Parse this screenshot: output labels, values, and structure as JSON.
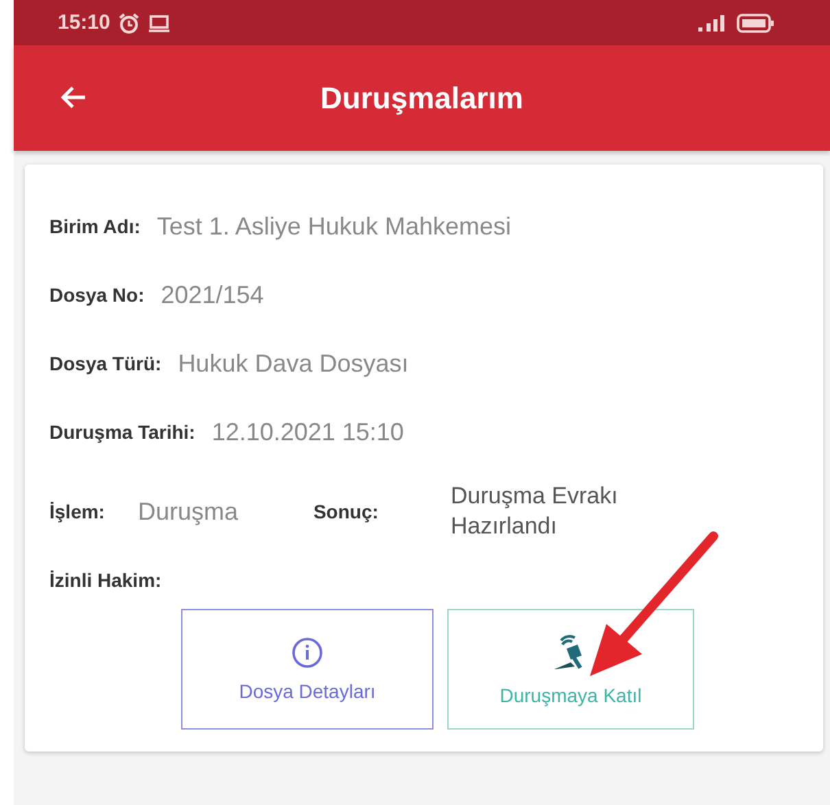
{
  "status_bar": {
    "time": "15:10"
  },
  "app_bar": {
    "title": "Duruşmalarım"
  },
  "fields": [
    {
      "label": "Birim Adı:",
      "value": "Test 1. Asliye Hukuk Mahkemesi"
    },
    {
      "label": "Dosya No:",
      "value": "2021/154"
    },
    {
      "label": "Dosya Türü:",
      "value": "Hukuk Dava Dosyası"
    },
    {
      "label": "Duruşma Tarihi:",
      "value": "12.10.2021 15:10"
    }
  ],
  "pair_row": [
    {
      "label": "İşlem:",
      "value": "Duruşma"
    },
    {
      "label": "Sonuç:",
      "value": "Duruşma Evrakı Hazırlandı"
    }
  ],
  "judge": {
    "label": "İzinli Hakim:"
  },
  "buttons": [
    {
      "kind": "info",
      "label": "Dosya Detayları"
    },
    {
      "kind": "join",
      "label": "Duruşmaya Katıl"
    }
  ]
}
